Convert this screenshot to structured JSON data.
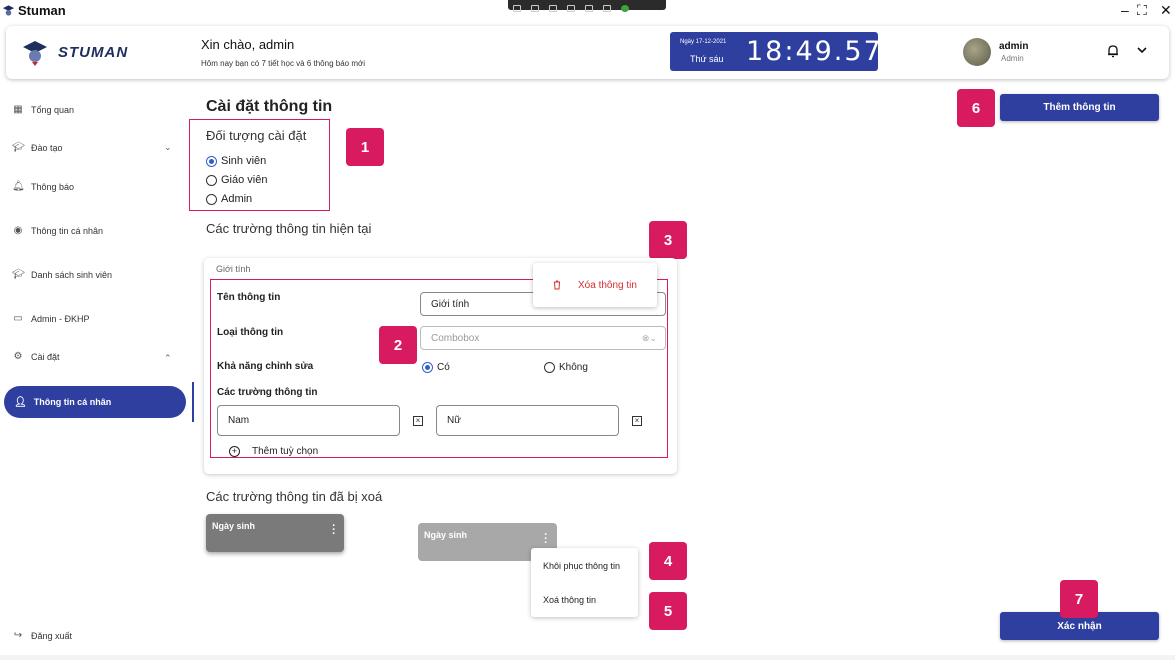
{
  "window": {
    "title": "Stuman",
    "controls": [
      "–",
      "⛶",
      "✕"
    ]
  },
  "header": {
    "brand": "STUMAN",
    "greeting": "Xin chào,  admin",
    "subtitle": "Hôm nay bạn có 7 tiết học và 6 thông báo mới",
    "date": "Ngày 17-12-2021",
    "weekday": "Thứ sáu",
    "time": "18:49.57",
    "user_name": "admin",
    "user_role": "Admin"
  },
  "sidebar": {
    "items": [
      {
        "label": "Tổng quan",
        "icon": "grid-icon"
      },
      {
        "label": "Đào tạo",
        "icon": "graduation-cap-icon",
        "caret": "⌄"
      },
      {
        "label": "Thông báo",
        "icon": "bell-icon"
      },
      {
        "label": "Thông tin cá nhân",
        "icon": "user-circle-icon"
      },
      {
        "label": "Danh sách sinh viên",
        "icon": "graduation-cap-icon"
      },
      {
        "label": "Admin - ĐKHP",
        "icon": "form-icon"
      },
      {
        "label": "Cài đặt",
        "icon": "gear-icon",
        "caret": "⌃"
      }
    ],
    "active": {
      "label": "Thông tin cá nhân",
      "icon": "person-icon"
    },
    "logout": "Đăng xuất"
  },
  "main": {
    "page_title": "Cài đặt thông tin",
    "target_section": {
      "title": "Đối tượng cài đặt",
      "options": [
        "Sinh viên",
        "Giáo viên",
        "Admin"
      ],
      "selected": "Sinh viên"
    },
    "current_fields_title": "Các trường thông tin hiện tại",
    "field_card": {
      "label": "Giới tính",
      "name_label": "Tên thông tin",
      "name_value": "Giới tính",
      "type_label": "Loại thông tin",
      "type_placeholder": "Combobox",
      "editable_label": "Khả năng chỉnh sửa",
      "editable_yes": "Có",
      "editable_no": "Không",
      "editable_selected": "Có",
      "options_label": "Các trường thông tin",
      "options": [
        "Nam",
        "Nữ"
      ],
      "add_option": "Thêm tuỳ chọn",
      "delete_popup": "Xóa thông tin"
    },
    "deleted_fields_title": "Các trường thông tin đã bị xoá",
    "deleted_fields": [
      "Ngày sinh",
      "Ngày sinh"
    ],
    "context_menu": [
      "Khôi phục thông tin",
      "Xoá thông tin"
    ],
    "add_button": "Thêm thông tin",
    "confirm_button": "Xác nhận"
  },
  "annotations": [
    "1",
    "2",
    "3",
    "4",
    "5",
    "6",
    "7"
  ],
  "colors": {
    "primary": "#2f3fa0",
    "highlight": "#d81b60",
    "deleted_card_dark": "#7a7a7a",
    "deleted_card_light": "#a8a8a8"
  }
}
